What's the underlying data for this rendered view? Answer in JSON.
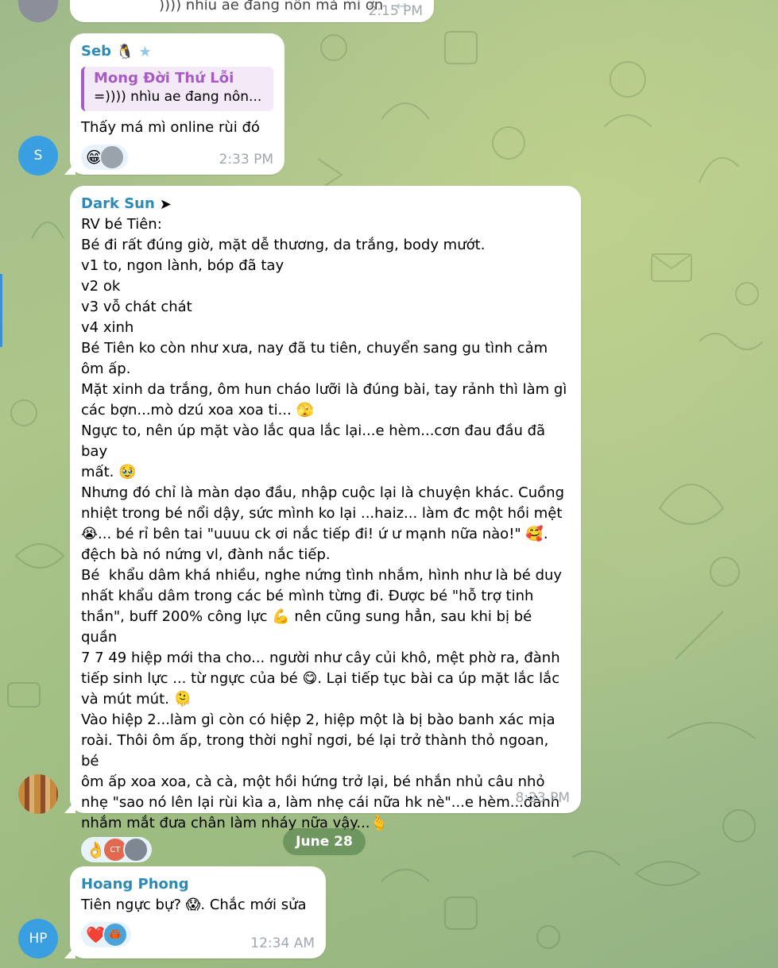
{
  "top_message": {
    "text": ")))) nhìu ae đang nôn mà mi ơn",
    "time": "2:15 PM"
  },
  "messages": [
    {
      "sender": "Seb",
      "sender_badges": [
        "penguin-emoji",
        "star-icon"
      ],
      "avatar_initial": "S",
      "avatar_color": "#3a9fe0",
      "reply": {
        "author": "Mong Đời Thứ Lỗi",
        "text": "=)))) nhìu ae đang nôn..."
      },
      "text": "Thấy má mì online rùi đó",
      "reactions": {
        "emoji": "😁"
      },
      "time": "2:33 PM"
    },
    {
      "sender": "Dark Sun",
      "lines": [
        "RV bé Tiên:",
        "Bé đi rất đúng giờ, mặt dễ thương, da trắng, body mướt.",
        "v1 to, ngon lành, bóp đã tay",
        "v2 ok",
        "v3 vỗ chát chát",
        "v4 xinh",
        "Bé Tiên ko còn như xưa, nay đã tu tiên, chuyển sang gu tình cảm",
        "ôm ấp.",
        "Mặt xinh da trắng, ôm hun cháo lưỡi là đúng bài, tay rảnh thì làm gì",
        "các bợn...mò dzú xoa xoa ti... 🫣",
        "Ngực to, nên úp mặt vào lắc qua lắc lại...e hèm...cơn đau đầu đã bay",
        "mất. 🥹",
        "Nhưng đó chỉ là màn dạo đầu, nhập cuộc lại là chuyện khác. Cuồng",
        "nhiệt trong bé nổi dậy, sức mình ko lại ...haiz... làm đc một hồi mệt",
        "😭... bé rỉ bên tai \"uuuu ck ơi nắc tiếp đi! ứ ư mạnh nữa nào!\" 🥰.",
        "đệch bà nó nứng vl, đành nắc tiếp.",
        "Bé  khẩu dâm khá nhiều, nghe nứng tình nhắm, hình như là bé duy",
        "nhất khẩu dâm trong các bé mình từng đi. Được bé \"hỗ trợ tinh",
        "thần\", buff 200% công lực 💪 nên cũng sung hẳn, sau khi bị bé quần",
        "7 7 49 hiệp mới tha cho... người như cây củi khô, mệt phờ ra, đành",
        "tiếp sinh lực ... từ ngực của bé 😋. Lại tiếp tục bài ca úp mặt lắc lắc",
        "và mút mút. 🫠",
        "Vào hiệp 2...làm gì còn có hiệp 2, hiệp một là bị bào banh xác mịa",
        "roài. Thôi ôm ấp, trong thời nghỉ ngơi, bé lại trở thành thỏ ngoan, bé",
        "ôm ấp xoa xoa, cà cà, một hồi hứng trở lại, bé nhắn nhủ câu nhỏ",
        "nhẹ \"sao nó lên lại rùi kìa a, làm nhẹ cái nữa hk nè\"...e hèm...đành",
        "nhắm mắt đưa chân làm nháy nữa vậy...🫰"
      ],
      "reactions": {
        "emoji": "👌",
        "avatar_initials": "CT"
      },
      "time": "8:23 PM"
    },
    {
      "sender": "Hoang Phong",
      "avatar_initial": "HP",
      "avatar_color": "#3a9fe0",
      "text": "Tiên ngực bự? 😱. Chắc mới sửa",
      "reactions": {
        "emoji": "❤️",
        "emoji2": "🦀"
      },
      "time": "12:34 AM"
    }
  ],
  "date_separator": "June 28",
  "colors": {
    "sender_blue": "#2e89b5",
    "reply_violet": "#a65cc4",
    "avatar_blue": "#3a9fe0",
    "date_badge": "#5a8a4b"
  }
}
